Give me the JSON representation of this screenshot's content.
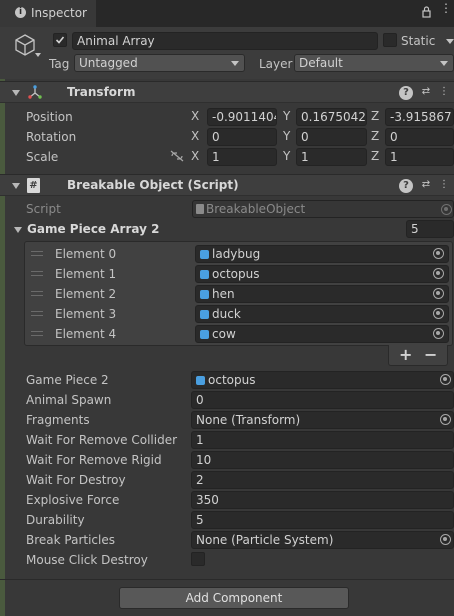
{
  "tab": {
    "title": "Inspector"
  },
  "object": {
    "name": "Animal Array",
    "static_label": "Static",
    "tag_label": "Tag",
    "tag_value": "Untagged",
    "layer_label": "Layer",
    "layer_value": "Default"
  },
  "transform": {
    "title": "Transform",
    "rows": [
      {
        "label": "Position",
        "x": "-0.9011404",
        "y": "0.1675042",
        "z": "-3.915867"
      },
      {
        "label": "Rotation",
        "x": "0",
        "y": "0",
        "z": "0"
      },
      {
        "label": "Scale",
        "x": "1",
        "y": "1",
        "z": "1"
      }
    ],
    "axis": {
      "x": "X",
      "y": "Y",
      "z": "Z"
    }
  },
  "script_component": {
    "title": "Breakable Object (Script)",
    "script_label": "Script",
    "script_value": "BreakableObject",
    "array_label": "Game Piece Array 2",
    "array_size": "5",
    "elements": [
      {
        "label": "Element 0",
        "value": "ladybug"
      },
      {
        "label": "Element 1",
        "value": "octopus"
      },
      {
        "label": "Element 2",
        "value": "hen"
      },
      {
        "label": "Element 3",
        "value": "duck"
      },
      {
        "label": "Element 4",
        "value": "cow"
      }
    ],
    "add_symbol": "+",
    "remove_symbol": "−",
    "props": [
      {
        "label": "Game Piece 2",
        "value": "octopus",
        "kind": "object"
      },
      {
        "label": "Animal Spawn",
        "value": "0",
        "kind": "number"
      },
      {
        "label": "Fragments",
        "value": "None (Transform)",
        "kind": "object-none"
      },
      {
        "label": "Wait For Remove Collider",
        "value": "1",
        "kind": "number"
      },
      {
        "label": "Wait For Remove Rigid",
        "value": "10",
        "kind": "number"
      },
      {
        "label": "Wait For Destroy",
        "value": "2",
        "kind": "number"
      },
      {
        "label": "Explosive Force",
        "value": "350",
        "kind": "number"
      },
      {
        "label": "Durability",
        "value": "5",
        "kind": "number"
      },
      {
        "label": "Break Particles",
        "value": "None (Particle System)",
        "kind": "object-none"
      },
      {
        "label": "Mouse Click Destroy",
        "value": "",
        "kind": "checkbox"
      }
    ]
  },
  "add_component": {
    "label": "Add Component"
  }
}
